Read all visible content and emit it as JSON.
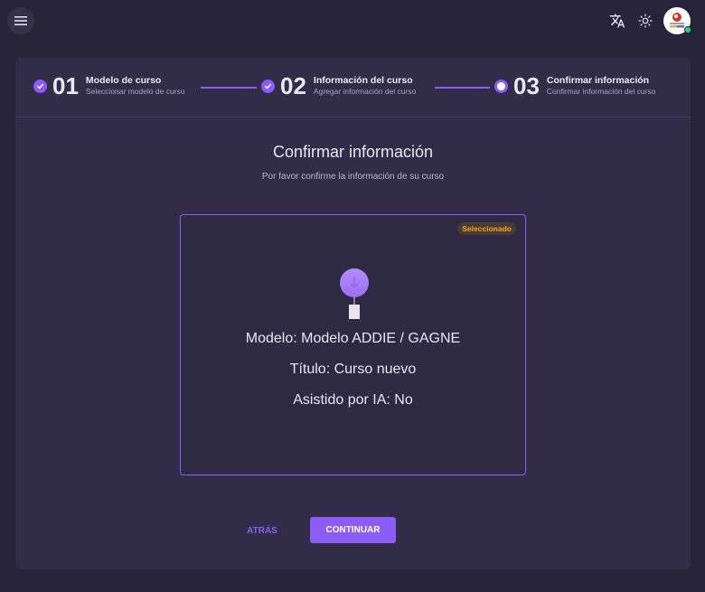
{
  "topbar": {
    "menu_icon": "menu-icon",
    "translate_icon": "translate-icon",
    "theme_icon": "sun-icon",
    "avatar_icon": "user-avatar"
  },
  "stepper": {
    "steps": [
      {
        "number": "01",
        "title": "Modelo de curso",
        "subtitle": "Seleccionar modelo de curso",
        "status": "completed"
      },
      {
        "number": "02",
        "title": "Información del curso",
        "subtitle": "Agregar información del curso",
        "status": "completed"
      },
      {
        "number": "03",
        "title": "Confirmar información",
        "subtitle": "Confirmar información del curso",
        "status": "current"
      }
    ]
  },
  "main": {
    "title": "Confirmar información",
    "subtitle": "Por favor confirme la información de su curso"
  },
  "model_card": {
    "badge": "Seleccionado",
    "model": "Modelo: Modelo ADDIE / GAGNE",
    "course_title": "Título: Curso nuevo",
    "ai_assisted": "Asistido por IA: No"
  },
  "actions": {
    "back_label": "ATRÁS",
    "continue_label": "CONTINUAR"
  },
  "colors": {
    "accent": "#8b5cf6",
    "background": "#27243a",
    "card": "#312d48",
    "badge_text": "#f5a524",
    "online": "#2fd27a"
  }
}
